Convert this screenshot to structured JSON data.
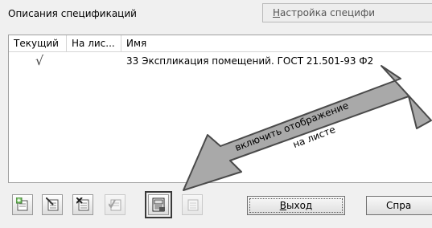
{
  "panel": {
    "title": "Описания спецификаций",
    "settings_button_hotkey": "Н",
    "settings_button_rest": "астройка специфи"
  },
  "table": {
    "columns": [
      "Текущий",
      "На лис...",
      "Имя"
    ],
    "rows": [
      {
        "current": "√",
        "on_sheet": "",
        "name": "33 Экспликация помещений. ГОСТ 21.501-93 Ф2"
      }
    ]
  },
  "callout": {
    "line1": "включить отображение",
    "line2": "на листе"
  },
  "buttons": {
    "exit_hotkey": "В",
    "exit_rest": "ыход",
    "reference_partial": "Спра"
  },
  "colors": {
    "arrow_fill": "#a9a9a9",
    "arrow_stroke": "#4a4a4a",
    "background": "#f0f0f0"
  },
  "icons": [
    "add-description-icon",
    "edit-description-icon",
    "delete-description-icon",
    "copy-description-icon",
    "show-on-sheet-icon",
    "properties-icon"
  ]
}
